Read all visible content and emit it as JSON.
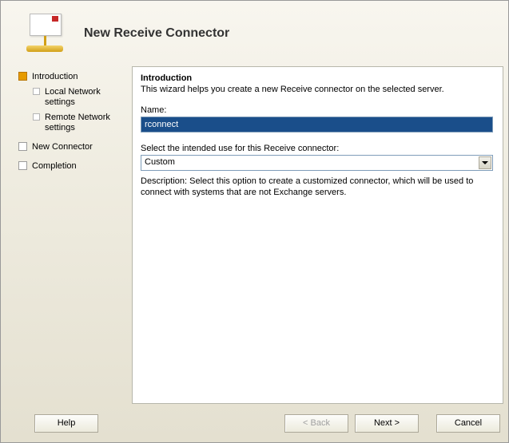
{
  "header": {
    "title": "New Receive Connector"
  },
  "sidebar": {
    "steps": [
      {
        "label": "Introduction",
        "current": true,
        "substeps": [
          {
            "label": "Local Network settings"
          },
          {
            "label": "Remote Network settings"
          }
        ]
      },
      {
        "label": "New Connector",
        "current": false
      },
      {
        "label": "Completion",
        "current": false
      }
    ]
  },
  "content": {
    "heading": "Introduction",
    "intro": "This wizard helps you create a new Receive connector on the selected server.",
    "name_label": "Name:",
    "name_value": "rconnect",
    "use_label": "Select the intended use for this Receive connector:",
    "use_value": "Custom",
    "description": "Description: Select this option to create a customized connector, which will be used to connect with systems that are not Exchange servers."
  },
  "footer": {
    "help": "Help",
    "back": "< Back",
    "next": "Next >",
    "cancel": "Cancel"
  }
}
